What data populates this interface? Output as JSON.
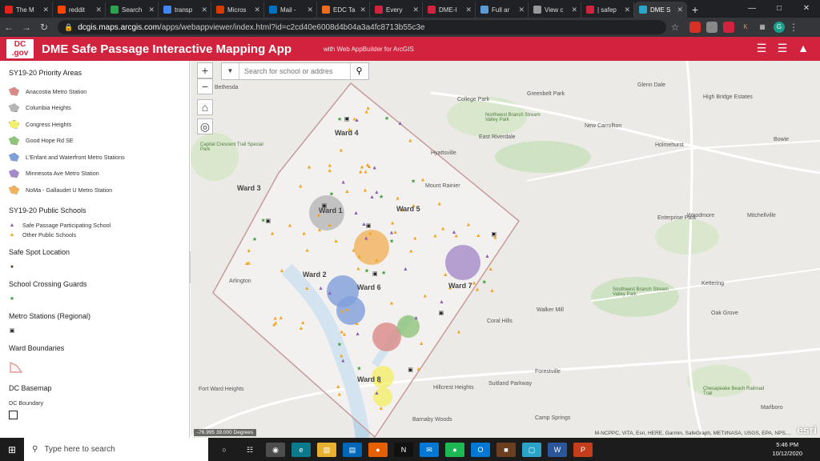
{
  "browser": {
    "tabs": [
      {
        "label": "The M",
        "color": "#e62117"
      },
      {
        "label": "reddit",
        "color": "#ff4500"
      },
      {
        "label": "Search",
        "color": "#2aa44f"
      },
      {
        "label": "transp",
        "color": "#4285f4"
      },
      {
        "label": "Micros",
        "color": "#d83b01"
      },
      {
        "label": "Mail -",
        "color": "#0072c6"
      },
      {
        "label": "EDC Ta",
        "color": "#ec6b1f"
      },
      {
        "label": "Every",
        "color": "#d2233e"
      },
      {
        "label": "DME-I",
        "color": "#d2233e"
      },
      {
        "label": "Full ar",
        "color": "#5b9bd5"
      },
      {
        "label": "View c",
        "color": "#999999"
      },
      {
        "label": "| safep",
        "color": "#d2233e"
      },
      {
        "label": "DME S",
        "color": "#2aa5c9",
        "active": true
      }
    ],
    "url_domain": "dcgis.maps.arcgis.com",
    "url_path": "/apps/webappviewer/index.html?id=c2cd40e6008d4b04a3a4fc8713b55c3e",
    "profile_initial": "G"
  },
  "app": {
    "logo_line1": "DC",
    "logo_line2": ".gov",
    "title": "DME Safe Passage Interactive Mapping App",
    "subtitle": "with Web AppBuilder for ArcGIS"
  },
  "legend": {
    "priority_title": "SY19-20 Priority Areas",
    "priority_areas": [
      {
        "label": "Anacostia Metro Station",
        "color": "#d98a86"
      },
      {
        "label": "Columbia Heights",
        "color": "#b6b6b6"
      },
      {
        "label": "Congress Heights",
        "color": "#f2ef6a"
      },
      {
        "label": "Good Hope Rd SE",
        "color": "#8fc47a"
      },
      {
        "label": "L'Enfant and Waterfront Metro Stations",
        "color": "#7f9fd9"
      },
      {
        "label": "Minnesota Ave Metro Station",
        "color": "#a58bc9"
      },
      {
        "label": "NoMa - Gallaudet U Metro Station",
        "color": "#f1b35c"
      }
    ],
    "schools_title": "SY19-20 Public Schools",
    "schools": [
      {
        "label": "Safe Passage Participating School",
        "color": "#8b5fb5"
      },
      {
        "label": "Other Public Schools",
        "color": "#f2a41f"
      }
    ],
    "safe_spot_title": "Safe Spot Location",
    "crossing_title": "School Crossing Guards",
    "metro_title": "Metro Stations (Regional)",
    "ward_title": "Ward Boundaries",
    "basemap_title": "DC Basemap",
    "basemap_sub": "DC Boundary"
  },
  "map": {
    "search_placeholder": "Search for school or addres",
    "coords": "-76.995 39.000 Degrees",
    "attribution": "M-NCPPC, VITA, Esri, HERE, Garmin, SafeGraph, METI/NASA, USGS, EPA, NPS,...",
    "esri": "esri",
    "wards": [
      "Ward 1",
      "Ward 2",
      "Ward 3",
      "Ward 4",
      "Ward 5",
      "Ward 6",
      "Ward 7",
      "Ward 8"
    ],
    "places": [
      "Bethesda",
      "College Park",
      "Greenbelt Park",
      "Glenn Dale",
      "High Bridge Estates",
      "New Carrollton",
      "Holmehurst",
      "East Riverdale",
      "Hyattsville",
      "Mount Rainier",
      "Bowie",
      "Woodmore",
      "Mitchellville",
      "Enterprise Park",
      "Arlington",
      "Kettering",
      "Walker Mill",
      "Oak Grove",
      "Coral Hills",
      "Forestville",
      "Hillcrest Heights",
      "Fort Ward Heights",
      "Camp Springs",
      "Barnaby Woods",
      "Suitland Parkway",
      "Marlboro",
      "Capital Crescent Trail Special Park",
      "Northwest Branch Stream Valley Park",
      "Southwest Branch Stream Valley Park",
      "Chesapeake Beach Railroad Trail"
    ]
  },
  "taskbar": {
    "search_text": "Type here to search",
    "time": "5:46 PM",
    "date": "10/12/2020"
  }
}
